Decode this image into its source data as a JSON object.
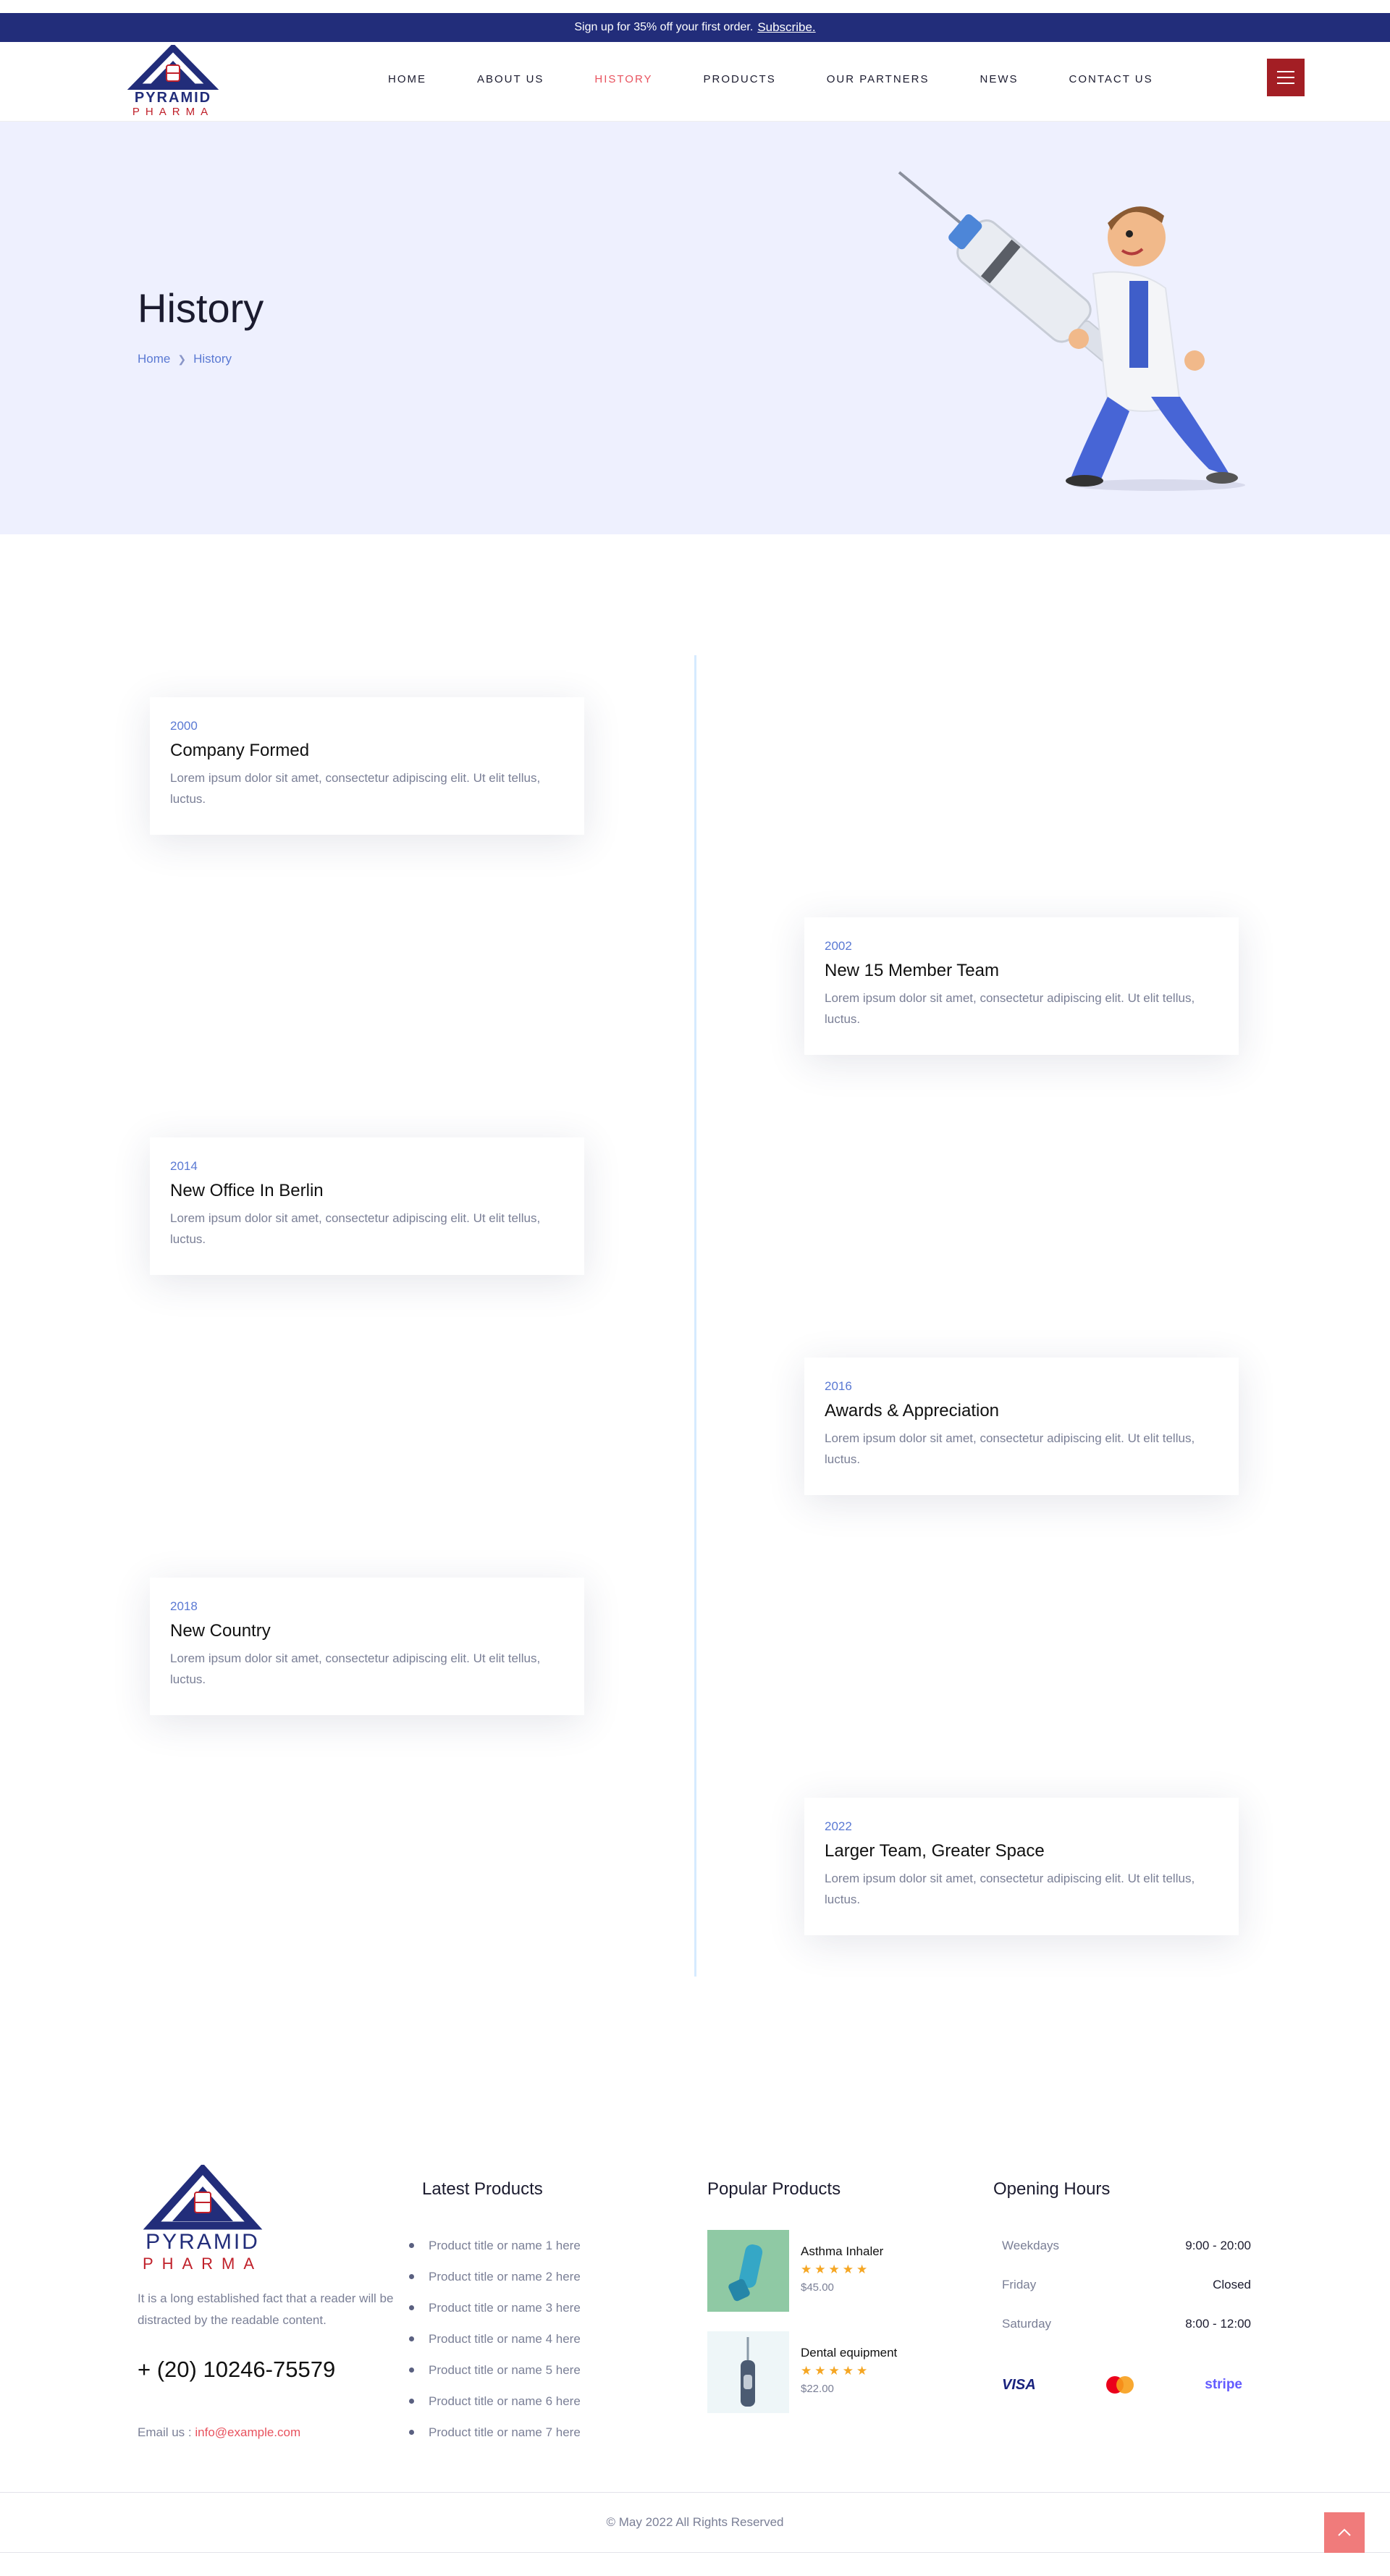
{
  "announcement": {
    "text": "Sign up for 35% off your first order.",
    "link": "Subscribe."
  },
  "brand": {
    "line1": "PYRAMID",
    "line2": "PHARMA"
  },
  "nav": {
    "items": [
      "HOME",
      "ABOUT US",
      "HISTORY",
      "PRODUCTS",
      "OUR PARTNERS",
      "NEWS",
      "CONTACT US"
    ],
    "active": "HISTORY"
  },
  "hero": {
    "title": "History",
    "breadcrumb": [
      "Home",
      "History"
    ]
  },
  "timeline": [
    {
      "year": "2000",
      "title": "Company Formed",
      "text": "Lorem ipsum dolor sit amet, consectetur adipiscing elit. Ut elit tellus, luctus."
    },
    {
      "year": "2002",
      "title": "New 15 Member Team",
      "text": "Lorem ipsum dolor sit amet, consectetur adipiscing elit. Ut elit tellus, luctus."
    },
    {
      "year": "2014",
      "title": "New Office In Berlin",
      "text": "Lorem ipsum dolor sit amet, consectetur adipiscing elit. Ut elit tellus, luctus."
    },
    {
      "year": "2016",
      "title": "Awards & Appreciation",
      "text": "Lorem ipsum dolor sit amet, consectetur adipiscing elit. Ut elit tellus, luctus."
    },
    {
      "year": "2018",
      "title": "New Country",
      "text": "Lorem ipsum dolor sit amet, consectetur adipiscing elit. Ut elit tellus, luctus."
    },
    {
      "year": "2022",
      "title": "Larger Team, Greater Space",
      "text": "Lorem ipsum dolor sit amet, consectetur adipiscing elit. Ut elit tellus, luctus."
    }
  ],
  "footer": {
    "about": "It is a long established fact that a reader will be distracted by the readable content.",
    "phone": "+ (20) 10246-75579",
    "email_label": "Email us :",
    "email": "info@example.com",
    "latest_title": "Latest Products",
    "latest": [
      "Product title or name 1 here",
      "Product title or name 2 here",
      "Product title or name 3 here",
      "Product title or name 4 here",
      "Product title or name 5 here",
      "Product title or name 6 here",
      "Product title or name 7 here"
    ],
    "popular_title": "Popular Products",
    "popular": [
      {
        "name": "Asthma Inhaler",
        "stars": "★★★★★",
        "price": "$45.00"
      },
      {
        "name": "Dental equipment",
        "stars": "★★★★★",
        "price": "$22.00"
      }
    ],
    "hours_title": "Opening Hours",
    "hours": [
      {
        "day": "Weekdays",
        "time": "9:00 - 20:00"
      },
      {
        "day": "Friday",
        "time": "Closed"
      },
      {
        "day": "Saturday",
        "time": "8:00 - 12:00"
      }
    ],
    "payments": [
      "VISA",
      "stripe"
    ],
    "copyright": "© May 2022 All Rights Reserved"
  },
  "colors": {
    "navy": "#222d7a",
    "red": "#a31e24",
    "accent": "#e8525e",
    "blue_text": "#5a79d3",
    "hero_bg": "#eef0fe"
  }
}
